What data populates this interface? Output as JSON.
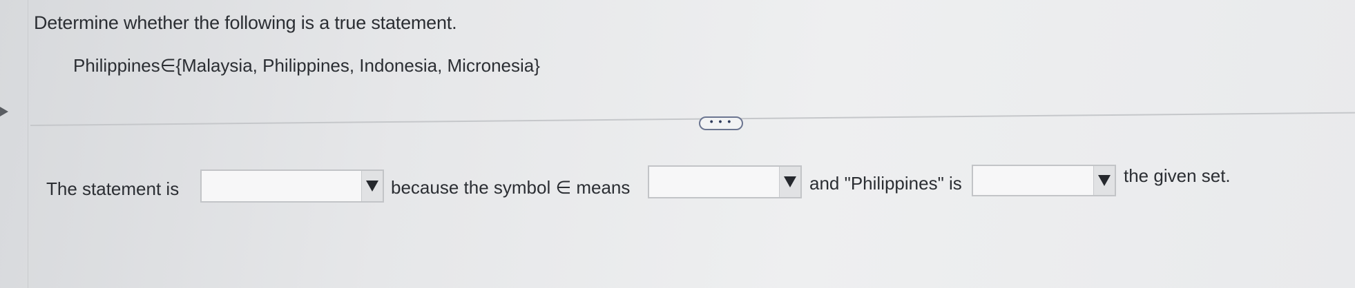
{
  "question": {
    "instruction": "Determine whether the following is a true statement.",
    "statement": "Philippines∈{Malaysia, Philippines, Indonesia, Micronesia}"
  },
  "more_button": {
    "icon": "ellipsis-icon",
    "glyph": "• • •"
  },
  "answer": {
    "part1": "The statement is",
    "part2": "because the symbol ∈ means",
    "part3": "and \"Philippines\" is",
    "part4": "the given set.",
    "dropdowns": [
      {
        "selected": ""
      },
      {
        "selected": ""
      },
      {
        "selected": ""
      }
    ]
  },
  "colors": {
    "background": "#e6e7e9",
    "text": "#2b2e33",
    "button_border": "#6b7590"
  }
}
